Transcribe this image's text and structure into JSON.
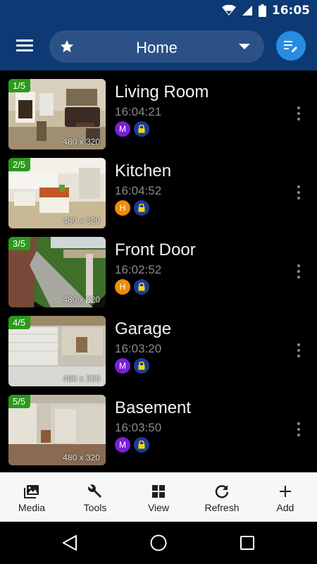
{
  "status_bar": {
    "time": "16:05",
    "icons": [
      "wifi-icon",
      "signal-icon",
      "battery-icon"
    ]
  },
  "app_bar": {
    "location": "Home",
    "icons": {
      "menu": "hamburger-menu-icon",
      "favorite": "star-icon",
      "dropdown": "chevron-down-icon",
      "edit": "edit-list-icon"
    }
  },
  "colors": {
    "primary": "#0d3a75",
    "accent": "#2a8ce0",
    "badge_green": "#2a9b1a",
    "mode_m": "#7b1fd8",
    "mode_h": "#f08c00",
    "lock": "#1a3b9b"
  },
  "cameras": [
    {
      "index": "1/5",
      "resolution": "480 x 320",
      "name": "Living Room",
      "time": "16:04:21",
      "mode": "M",
      "mode_color": "#7b1fd8"
    },
    {
      "index": "2/5",
      "resolution": "480 x 320",
      "name": "Kitchen",
      "time": "16:04:52",
      "mode": "H",
      "mode_color": "#f08c00"
    },
    {
      "index": "3/5",
      "resolution": "480 x 320",
      "name": "Front Door",
      "time": "16:02:52",
      "mode": "H",
      "mode_color": "#f08c00"
    },
    {
      "index": "4/5",
      "resolution": "480 x 320",
      "name": "Garage",
      "time": "16:03:20",
      "mode": "M",
      "mode_color": "#7b1fd8"
    },
    {
      "index": "5/5",
      "resolution": "480 x 320",
      "name": "Basement",
      "time": "16:03:50",
      "mode": "M",
      "mode_color": "#7b1fd8"
    }
  ],
  "bottom_tabs": [
    {
      "label": "Media",
      "icon": "media-gallery-icon"
    },
    {
      "label": "Tools",
      "icon": "wrench-icon"
    },
    {
      "label": "View",
      "icon": "grid-view-icon"
    },
    {
      "label": "Refresh",
      "icon": "refresh-icon"
    },
    {
      "label": "Add",
      "icon": "plus-icon"
    }
  ],
  "nav_bar": {
    "icons": [
      "back-icon",
      "home-icon",
      "recents-icon"
    ]
  }
}
